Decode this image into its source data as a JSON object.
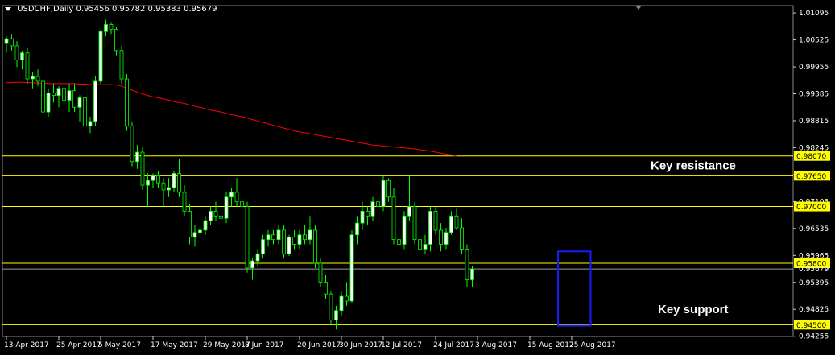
{
  "header": {
    "symbol": "USDCHF,Daily",
    "ohlc": "0.95456 0.95782 0.95383 0.95679"
  },
  "colors": {
    "background": "#000000",
    "bull_candle": "#ffffff",
    "bear_candle": "#000000",
    "wick": "#00ff00",
    "moving_average": "#ff0000",
    "level_line": "#ffff00",
    "box": "#1a1aff",
    "axis_text": "#ffffff"
  },
  "chart_data": {
    "type": "candlestick",
    "title": "USDCHF,Daily",
    "ylim": [
      0.9425,
      1.0125
    ],
    "y_ticks": [
      1.01095,
      1.00525,
      0.99955,
      0.99385,
      0.98815,
      0.98245,
      0.97675,
      0.97105,
      0.96535,
      0.95965,
      0.95395,
      0.94825,
      0.94255
    ],
    "x_ticks": [
      {
        "label": "13 Apr 2017",
        "index": 0
      },
      {
        "label": "25 Apr 2017",
        "index": 10
      },
      {
        "label": "5 May 2017",
        "index": 18
      },
      {
        "label": "17 May 2017",
        "index": 28
      },
      {
        "label": "29 May 2017",
        "index": 38
      },
      {
        "label": "8 Jun 2017",
        "index": 46
      },
      {
        "label": "20 Jun 2017",
        "index": 56
      },
      {
        "label": "30 Jun 2017",
        "index": 64
      },
      {
        "label": "12 Jul 2017",
        "index": 72
      },
      {
        "label": "24 Jul 2017",
        "index": 82
      },
      {
        "label": "3 Aug 2017",
        "index": 90
      },
      {
        "label": "15 Aug 2017",
        "index": 100
      },
      {
        "label": "25 Aug 2017",
        "index": 108
      }
    ],
    "series": [
      {
        "name": "USDCHF",
        "ohlc": [
          [
            1.0045,
            1.006,
            1.0025,
            1.0055
          ],
          [
            1.0055,
            1.0065,
            1.003,
            1.004
          ],
          [
            1.004,
            1.005,
            0.9995,
            1.001
          ],
          [
            1.001,
            1.003,
            0.999,
            1.0025
          ],
          [
            1.0025,
            1.0035,
            0.996,
            0.997
          ],
          [
            0.997,
            0.9985,
            0.995,
            0.9975
          ],
          [
            0.9975,
            0.999,
            0.9955,
            0.9965
          ],
          [
            0.9965,
            0.9975,
            0.989,
            0.99
          ],
          [
            0.99,
            0.995,
            0.989,
            0.994
          ],
          [
            0.994,
            0.996,
            0.992,
            0.9935
          ],
          [
            0.9935,
            0.9955,
            0.991,
            0.995
          ],
          [
            0.995,
            0.996,
            0.9915,
            0.9925
          ],
          [
            0.9925,
            0.996,
            0.99,
            0.9945
          ],
          [
            0.9945,
            0.996,
            0.99,
            0.991
          ],
          [
            0.991,
            0.9935,
            0.988,
            0.993
          ],
          [
            0.993,
            0.9945,
            0.986,
            0.987
          ],
          [
            0.987,
            0.989,
            0.9855,
            0.988
          ],
          [
            0.988,
            0.9975,
            0.987,
            0.9965
          ],
          [
            0.9965,
            1.0075,
            0.996,
            1.007
          ],
          [
            1.007,
            1.0095,
            1.006,
            1.0085
          ],
          [
            1.0085,
            1.009,
            1.0065,
            1.0075
          ],
          [
            1.0075,
            1.008,
            1.002,
            1.003
          ],
          [
            1.003,
            1.004,
            0.996,
            0.997
          ],
          [
            0.997,
            0.998,
            0.986,
            0.987
          ],
          [
            0.987,
            0.988,
            0.9785,
            0.9795
          ],
          [
            0.9795,
            0.983,
            0.978,
            0.9815
          ],
          [
            0.9815,
            0.9825,
            0.9735,
            0.9745
          ],
          [
            0.9745,
            0.977,
            0.97,
            0.9755
          ],
          [
            0.9755,
            0.977,
            0.974,
            0.9765
          ],
          [
            0.9765,
            0.9775,
            0.974,
            0.975
          ],
          [
            0.975,
            0.976,
            0.97,
            0.9735
          ],
          [
            0.9735,
            0.976,
            0.972,
            0.974
          ],
          [
            0.974,
            0.9775,
            0.973,
            0.977
          ],
          [
            0.977,
            0.98,
            0.972,
            0.973
          ],
          [
            0.973,
            0.9745,
            0.968,
            0.969
          ],
          [
            0.969,
            0.9705,
            0.962,
            0.9635
          ],
          [
            0.9635,
            0.966,
            0.9615,
            0.9645
          ],
          [
            0.9645,
            0.9665,
            0.963,
            0.965
          ],
          [
            0.965,
            0.968,
            0.964,
            0.967
          ],
          [
            0.967,
            0.97,
            0.966,
            0.969
          ],
          [
            0.969,
            0.971,
            0.967,
            0.968
          ],
          [
            0.968,
            0.969,
            0.966,
            0.9675
          ],
          [
            0.9675,
            0.973,
            0.9665,
            0.972
          ],
          [
            0.972,
            0.974,
            0.97,
            0.973
          ],
          [
            0.973,
            0.976,
            0.97,
            0.971
          ],
          [
            0.971,
            0.973,
            0.968,
            0.97
          ],
          [
            0.97,
            0.971,
            0.956,
            0.957
          ],
          [
            0.957,
            0.959,
            0.9545,
            0.9585
          ],
          [
            0.9585,
            0.961,
            0.9575,
            0.96
          ],
          [
            0.96,
            0.964,
            0.959,
            0.963
          ],
          [
            0.963,
            0.965,
            0.9615,
            0.964
          ],
          [
            0.964,
            0.965,
            0.962,
            0.963
          ],
          [
            0.963,
            0.966,
            0.962,
            0.965
          ],
          [
            0.965,
            0.966,
            0.959,
            0.96
          ],
          [
            0.96,
            0.964,
            0.9595,
            0.9635
          ],
          [
            0.9635,
            0.965,
            0.961,
            0.962
          ],
          [
            0.962,
            0.965,
            0.961,
            0.964
          ],
          [
            0.964,
            0.966,
            0.962,
            0.963
          ],
          [
            0.963,
            0.968,
            0.962,
            0.965
          ],
          [
            0.965,
            0.966,
            0.957,
            0.958
          ],
          [
            0.958,
            0.959,
            0.953,
            0.954
          ],
          [
            0.954,
            0.9555,
            0.9505,
            0.9515
          ],
          [
            0.9515,
            0.952,
            0.945,
            0.946
          ],
          [
            0.946,
            0.949,
            0.944,
            0.948
          ],
          [
            0.948,
            0.952,
            0.947,
            0.951
          ],
          [
            0.951,
            0.954,
            0.949,
            0.95
          ],
          [
            0.95,
            0.965,
            0.9495,
            0.964
          ],
          [
            0.964,
            0.968,
            0.962,
            0.9665
          ],
          [
            0.9665,
            0.971,
            0.965,
            0.969
          ],
          [
            0.969,
            0.97,
            0.966,
            0.968
          ],
          [
            0.968,
            0.972,
            0.967,
            0.971
          ],
          [
            0.971,
            0.974,
            0.969,
            0.97
          ],
          [
            0.97,
            0.9765,
            0.969,
            0.9755
          ],
          [
            0.9755,
            0.976,
            0.971,
            0.972
          ],
          [
            0.972,
            0.974,
            0.962,
            0.963
          ],
          [
            0.963,
            0.964,
            0.96,
            0.962
          ],
          [
            0.962,
            0.969,
            0.961,
            0.968
          ],
          [
            0.968,
            0.9765,
            0.967,
            0.97
          ],
          [
            0.97,
            0.971,
            0.962,
            0.963
          ],
          [
            0.963,
            0.965,
            0.959,
            0.961
          ],
          [
            0.961,
            0.964,
            0.96,
            0.962
          ],
          [
            0.962,
            0.97,
            0.9605,
            0.969
          ],
          [
            0.969,
            0.97,
            0.964,
            0.965
          ],
          [
            0.965,
            0.9665,
            0.9605,
            0.962
          ],
          [
            0.962,
            0.9655,
            0.961,
            0.9645
          ],
          [
            0.9645,
            0.969,
            0.964,
            0.968
          ],
          [
            0.968,
            0.9695,
            0.965,
            0.9655
          ],
          [
            0.9655,
            0.9675,
            0.96,
            0.961
          ],
          [
            0.961,
            0.962,
            0.953,
            0.9545
          ],
          [
            0.9545,
            0.9575,
            0.953,
            0.9568
          ]
        ]
      },
      {
        "name": "MA",
        "values": [
          0.9962,
          0.9962,
          0.9963,
          0.9963,
          0.9962,
          0.9962,
          0.9961,
          0.9961,
          0.996,
          0.996,
          0.996,
          0.996,
          0.996,
          0.996,
          0.9959,
          0.9959,
          0.9958,
          0.9958,
          0.9958,
          0.9958,
          0.9958,
          0.9957,
          0.9955,
          0.995,
          0.9946,
          0.9942,
          0.9938,
          0.9935,
          0.9932,
          0.993,
          0.9928,
          0.9925,
          0.9922,
          0.992,
          0.9918,
          0.9915,
          0.9912,
          0.991,
          0.9907,
          0.9904,
          0.9902,
          0.99,
          0.9897,
          0.9894,
          0.9892,
          0.989,
          0.9887,
          0.9884,
          0.9881,
          0.9878,
          0.9875,
          0.9872,
          0.9869,
          0.9866,
          0.9863,
          0.986,
          0.9858,
          0.9856,
          0.9854,
          0.9852,
          0.985,
          0.9848,
          0.9846,
          0.9844,
          0.9842,
          0.984,
          0.9838,
          0.9836,
          0.9834,
          0.9832,
          0.983,
          0.9829,
          0.9828,
          0.9827,
          0.9826,
          0.9825,
          0.9824,
          0.9823,
          0.9822,
          0.982,
          0.9819,
          0.9817,
          0.9815,
          0.9813,
          0.9811,
          0.9809,
          0.9806
        ]
      }
    ],
    "levels": [
      {
        "value": 0.9807,
        "label": "0.98070"
      },
      {
        "value": 0.9765,
        "label": "0.97650"
      },
      {
        "value": 0.97,
        "label": "0.97000"
      },
      {
        "value": 0.958,
        "label": "0.95800"
      },
      {
        "value": 0.945,
        "label": "0.94500"
      }
    ],
    "current_price": {
      "value": 0.95679,
      "label": "0.95679"
    },
    "annotations": [
      "Key resistance",
      "Key support"
    ],
    "highlight_box": {
      "x_from": 106,
      "x_to": 111,
      "y_from": 0.9448,
      "y_to": 0.9605
    }
  }
}
